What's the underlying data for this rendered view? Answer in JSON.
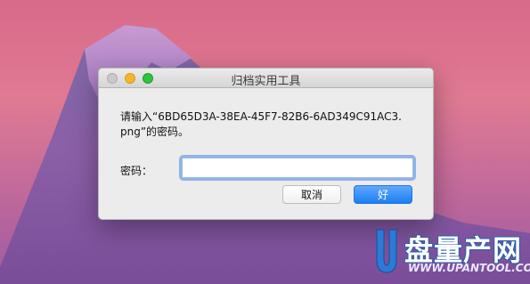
{
  "dialog": {
    "title": "归档实用工具",
    "message": "请输入“6BD65D3A-38EA-45F7-82B6-6AD349C91AC3.png”的密码。",
    "password_label": "密码：",
    "password_value": "",
    "cancel_label": "取消",
    "ok_label": "好"
  },
  "watermark": {
    "brand": "盘量产网",
    "url": "WWW.UPANTOOL.COM"
  },
  "colors": {
    "accent": "#1a7ef5",
    "close": "#c9c9c9",
    "minimize": "#f5b62c",
    "maximize": "#2fc33f"
  }
}
